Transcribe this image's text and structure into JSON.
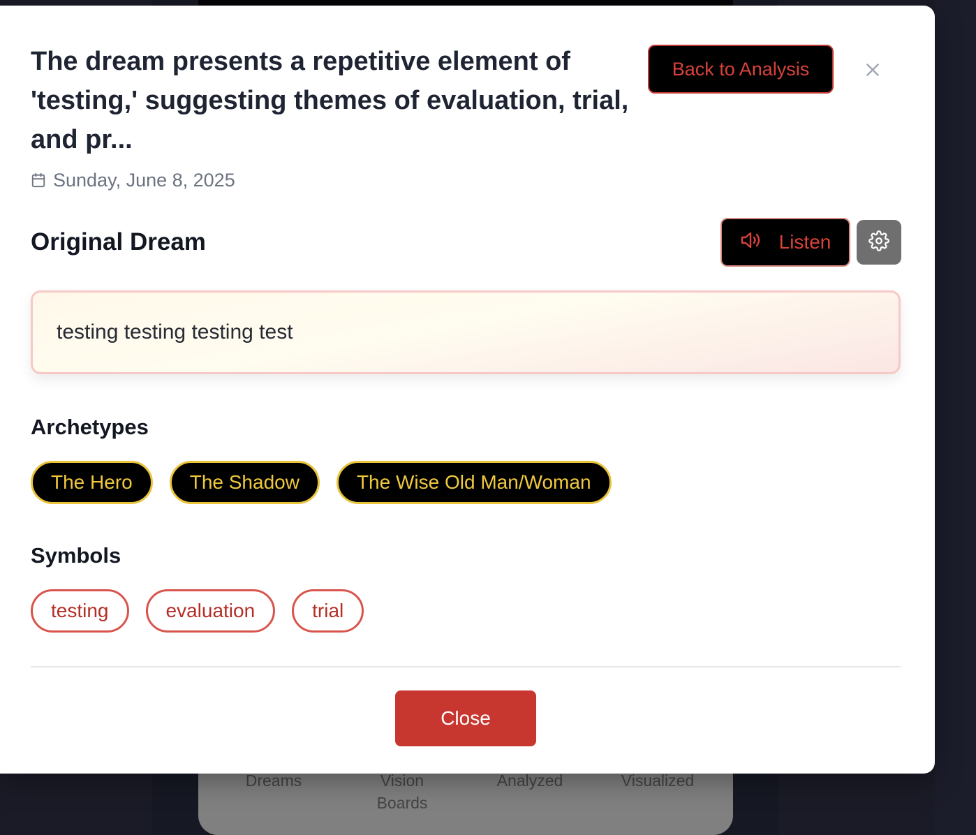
{
  "background": {
    "stats": [
      {
        "label": "Dreams"
      },
      {
        "label": "Vision\nBoards"
      },
      {
        "label": "Analyzed"
      },
      {
        "label": "Visualized"
      }
    ]
  },
  "modal": {
    "title": "The dream presents a repetitive element of 'testing,' suggesting themes of evaluation, trial, and pr...",
    "date": "Sunday, June 8, 2025",
    "back_button_label": "Back to Analysis",
    "close_icon": "close-icon",
    "original_dream": {
      "heading": "Original Dream",
      "listen_label": "Listen",
      "text": "testing testing testing test"
    },
    "archetypes": {
      "heading": "Archetypes",
      "items": [
        "The Hero",
        "The Shadow",
        "The Wise Old Man/Woman"
      ]
    },
    "symbols": {
      "heading": "Symbols",
      "items": [
        "testing",
        "evaluation",
        "trial"
      ]
    },
    "close_button_label": "Close"
  },
  "colors": {
    "accent_red": "#c8372f",
    "archetype_gold": "#e9c43a",
    "title_text": "#1f2433"
  }
}
